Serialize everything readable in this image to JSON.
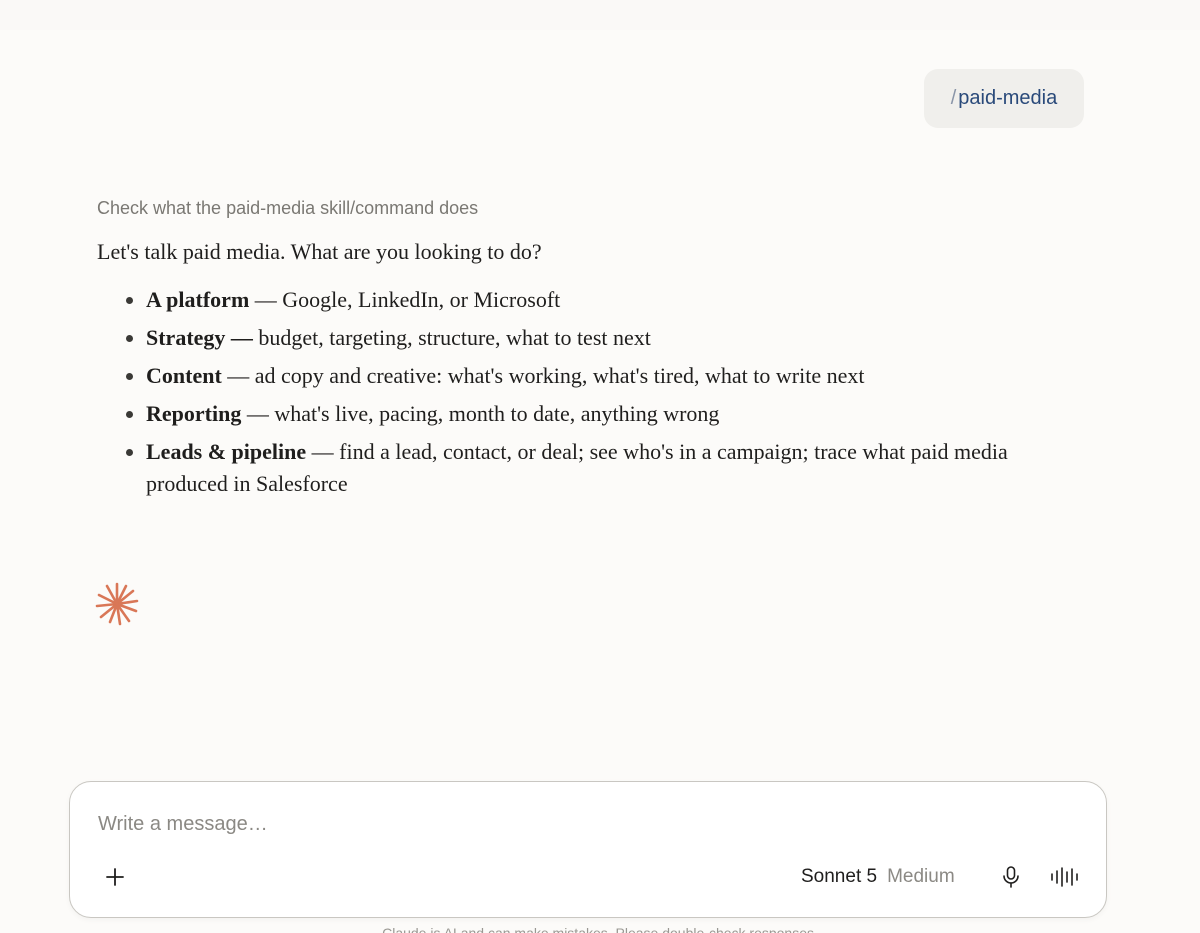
{
  "user_message": {
    "slash": "/",
    "command": "paid-media"
  },
  "assistant": {
    "thinking_summary": "Check what the paid-media skill/command does",
    "intro": "Let's talk paid media. What are you looking to do?",
    "options": [
      {
        "title": "A platform",
        "sep": " — ",
        "desc": "Google, LinkedIn, or Microsoft"
      },
      {
        "title": "Strategy —",
        "sep": " ",
        "desc": "budget, targeting, structure, what to test next"
      },
      {
        "title": "Content",
        "sep": " — ",
        "desc": "ad copy and creative: what's working, what's tired, what to write next"
      },
      {
        "title": "Reporting",
        "sep": " — ",
        "desc": "what's live, pacing, month to date, anything wrong"
      },
      {
        "title": "Leads & pipeline",
        "sep": " — ",
        "desc": "find a lead, contact, or deal; see who's in a campaign; trace what paid media produced in Salesforce"
      }
    ],
    "status_icon": "spark-icon",
    "accent_color": "#d97757"
  },
  "composer": {
    "placeholder": "Write a message…",
    "value": "",
    "model_name": "Sonnet 5",
    "effort": "Medium",
    "icons": [
      "plus-icon",
      "microphone-icon",
      "voice-waveform-icon"
    ]
  },
  "footer": {
    "disclaimer": "Claude is AI and can make mistakes. Please double-check responses."
  }
}
